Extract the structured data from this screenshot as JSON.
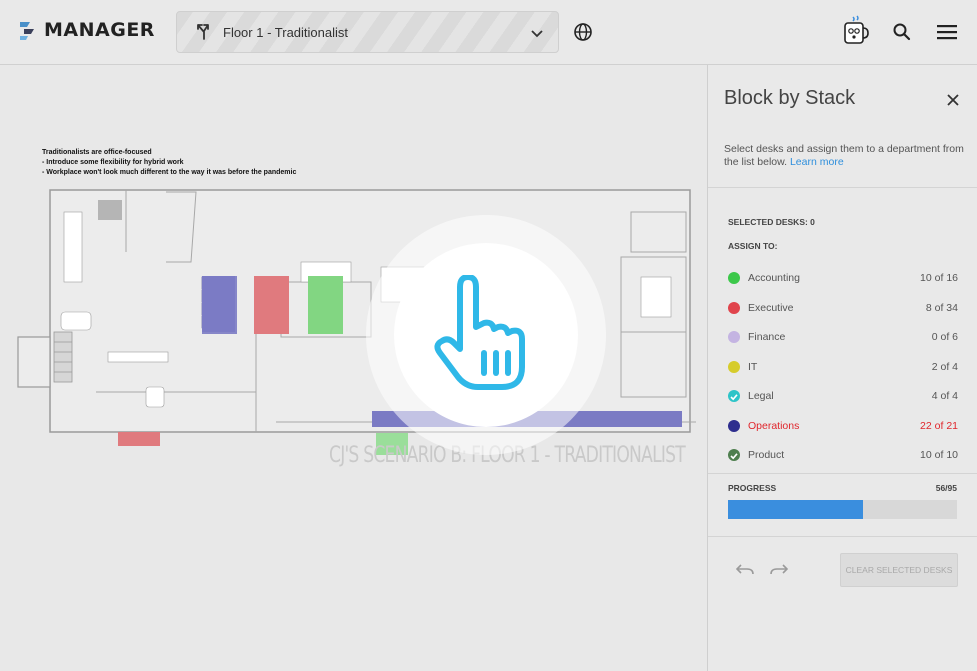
{
  "app": {
    "logo_text": "MANAGER"
  },
  "header": {
    "floor_select": {
      "value": "Floor 1 - Traditionalist"
    },
    "icons": [
      "globe-icon",
      "coffee-mascot-icon",
      "search-icon",
      "menu-icon"
    ]
  },
  "canvas": {
    "notes": [
      "Traditionalists are office-focused",
      "- Introduce some flexibility for hybrid work",
      "- Workplace won't look much different to the way it was before the pandemic"
    ],
    "scenario_label": "CJ'S SCENARIO B: FLOOR 1 - TRADITIONALIST"
  },
  "panel": {
    "title": "Block by Stack",
    "description": "Select desks and assign them to a department from the list below.",
    "learn_more": "Learn more",
    "selected_desks_label": "SELECTED DESKS: 0",
    "assign_to_label": "ASSIGN TO:",
    "departments": [
      {
        "name": "Accounting",
        "count": "10 of 16",
        "color": "#3cc84a",
        "icon": "dot"
      },
      {
        "name": "Executive",
        "count": "8 of 34",
        "color": "#e0444c",
        "icon": "dot"
      },
      {
        "name": "Finance",
        "count": "0 of 6",
        "color": "#c4b4e2",
        "icon": "dot"
      },
      {
        "name": "IT",
        "count": "2 of 4",
        "color": "#d6cc2c",
        "icon": "dot"
      },
      {
        "name": "Legal",
        "count": "4 of 4",
        "color": "#2ec4c8",
        "icon": "check"
      },
      {
        "name": "Operations",
        "count": "22 of 21",
        "color": "#2e2e8e",
        "icon": "dot",
        "over": true
      },
      {
        "name": "Product",
        "count": "10 of 10",
        "color": "#4f7f4f",
        "icon": "check"
      }
    ],
    "progress": {
      "label": "PROGRESS",
      "count": "56/95",
      "fraction": 0.589
    },
    "clear_button": "CLEAR SELECTED DESKS"
  }
}
